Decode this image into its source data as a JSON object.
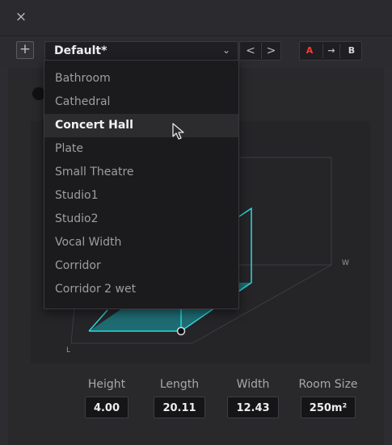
{
  "window": {
    "close_glyph": "×"
  },
  "toolbar": {
    "add_glyph": "+",
    "preset_value": "Default*",
    "chevron_glyph": "⌄",
    "prev_glyph": "<",
    "next_glyph": ">",
    "ab_a": "A",
    "ab_copy": "→",
    "ab_b": "B",
    "accent_color": "#ff3b30"
  },
  "dropdown": {
    "items": [
      "Bathroom",
      "Cathedral",
      "Concert Hall",
      "Plate",
      "Small Theatre",
      "Studio1",
      "Studio2",
      "Vocal Width",
      "Corridor",
      "Corridor 2 wet"
    ],
    "selected_index": 2
  },
  "room": {
    "axis_w": "W",
    "axis_l": "L",
    "accent_color": "#2fd7e0"
  },
  "params": {
    "height": {
      "label": "Height",
      "value": "4.00"
    },
    "length": {
      "label": "Length",
      "value": "20.11"
    },
    "width": {
      "label": "Width",
      "value": "12.43"
    },
    "room_size": {
      "label": "Room Size",
      "value": "250m²"
    }
  }
}
